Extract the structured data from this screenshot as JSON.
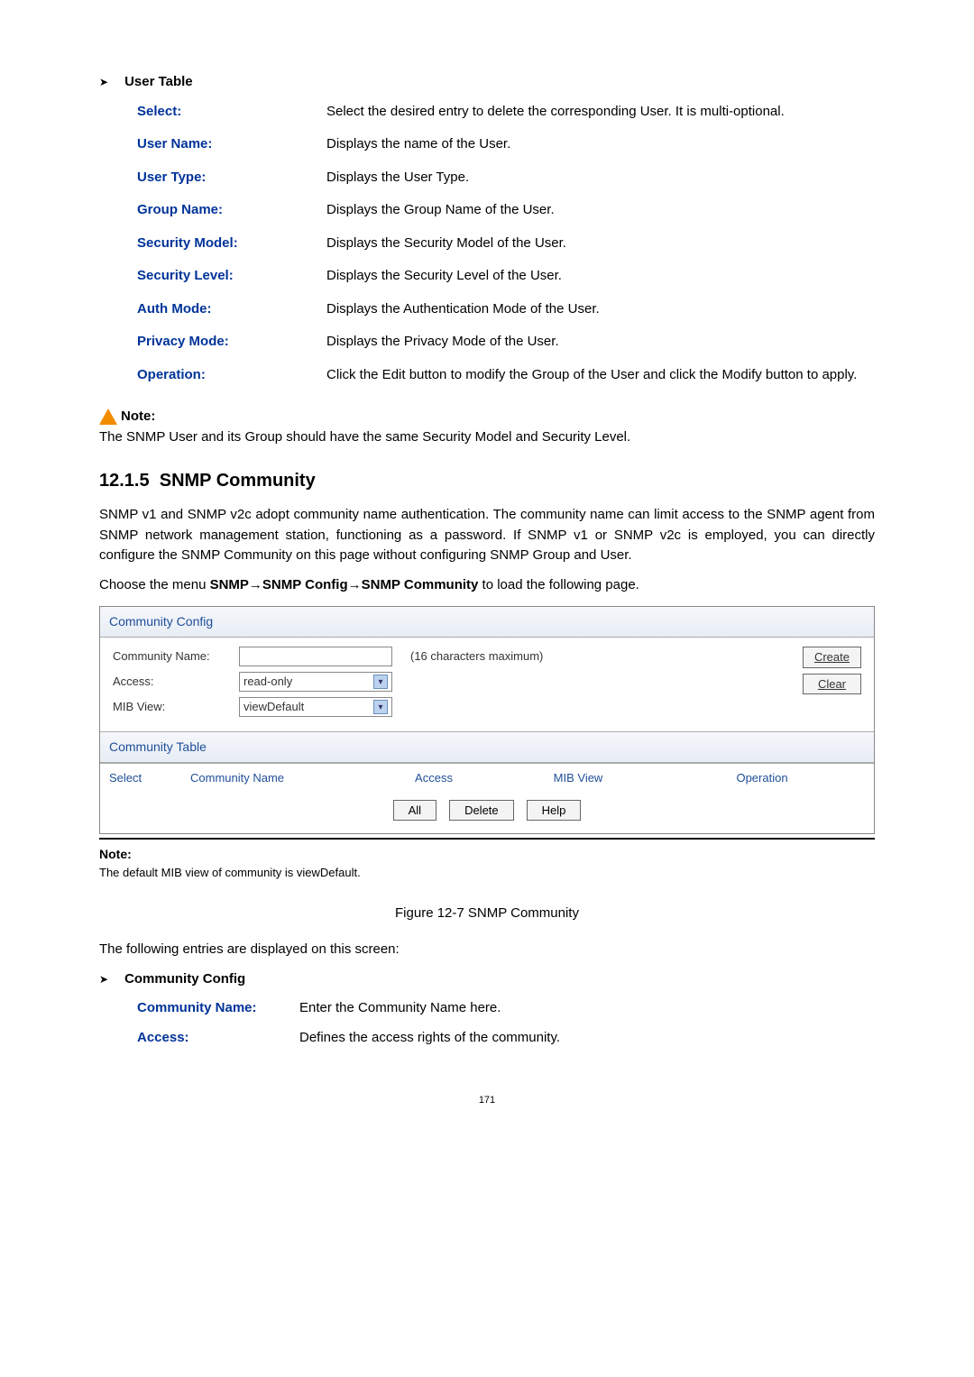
{
  "user_table": {
    "heading": "User Table",
    "rows": [
      {
        "term": "Select:",
        "desc": "Select the desired entry to delete the corresponding User. It is multi-optional."
      },
      {
        "term": "User Name:",
        "desc": "Displays the name of the User."
      },
      {
        "term": "User Type:",
        "desc": "Displays the User Type."
      },
      {
        "term": "Group Name:",
        "desc": "Displays the Group Name of the User."
      },
      {
        "term": "Security Model:",
        "desc": "Displays the Security Model of the User."
      },
      {
        "term": "Security Level:",
        "desc": "Displays the Security Level of the User."
      },
      {
        "term": "Auth Mode:",
        "desc": "Displays the Authentication Mode of the User."
      },
      {
        "term": "Privacy Mode:",
        "desc": "Displays the Privacy Mode of the User."
      },
      {
        "term": "Operation:",
        "desc": "Click the Edit button to modify the Group of the User and click the Modify button to apply."
      }
    ]
  },
  "note1": {
    "label": "Note:",
    "text": "The SNMP User and its Group should have the same Security Model and Security Level."
  },
  "section": {
    "num": "12.1.5",
    "title": "SNMP Community",
    "p1": "SNMP v1 and SNMP v2c adopt community name authentication. The community name can limit access to the SNMP agent from SNMP network management station, functioning as a password. If SNMP v1 or SNMP v2c is employed, you can directly configure the SNMP Community on this page without configuring SNMP Group and User.",
    "p2_prefix": "Choose the menu ",
    "p2_bold": "SNMP→SNMP Config→SNMP Community",
    "p2_suffix": " to load the following page."
  },
  "panel": {
    "cfg_title": "Community Config",
    "community_name_label": "Community Name:",
    "community_hint": "(16 characters maximum)",
    "access_label": "Access:",
    "access_value": "read-only",
    "mib_label": "MIB View:",
    "mib_value": "viewDefault",
    "create_btn": "Create",
    "clear_btn": "Clear",
    "tbl_title": "Community Table",
    "th_select": "Select",
    "th_name": "Community Name",
    "th_access": "Access",
    "th_mib": "MIB View",
    "th_op": "Operation",
    "all_btn": "All",
    "delete_btn": "Delete",
    "help_btn": "Help"
  },
  "under_note": {
    "label": "Note:",
    "text": "The default MIB view of community is viewDefault."
  },
  "figure_caption": "Figure 12-7 SNMP Community",
  "after_fig": "The following entries are displayed on this screen:",
  "community_cfg": {
    "heading": "Community Config",
    "rows": [
      {
        "term": "Community Name:",
        "desc": "Enter the Community Name here."
      },
      {
        "term": "Access:",
        "desc": "Defines the access rights of the community."
      }
    ]
  },
  "page_number": "171"
}
